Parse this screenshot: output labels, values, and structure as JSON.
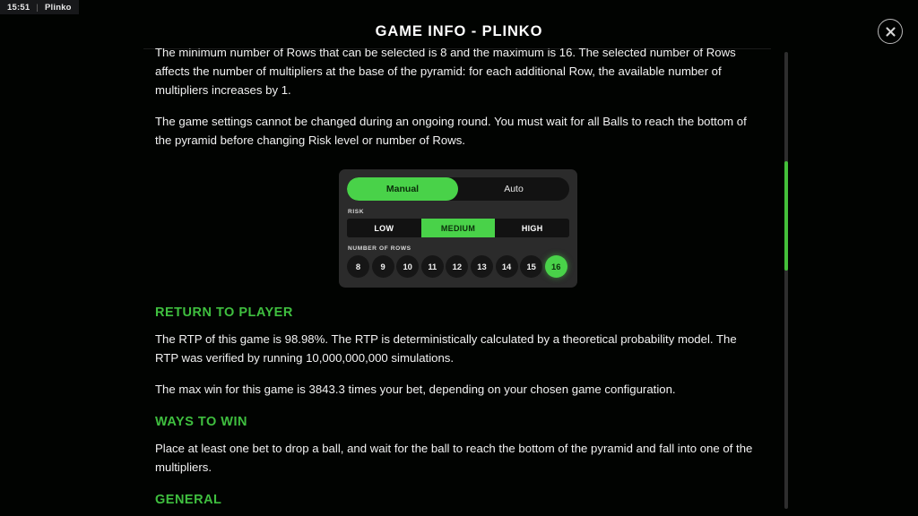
{
  "status_bar": {
    "time": "15:51",
    "separator": "|",
    "game_name": "Plinko"
  },
  "header": {
    "title": "GAME INFO - PLINKO",
    "close_label": "close-icon"
  },
  "content": {
    "paragraph_rows": "The minimum number of Rows that can be selected is 8 and the maximum is 16. The selected number of Rows affects the number of multipliers at the base of the pyramid: for each additional Row, the available number of multipliers increases by 1.",
    "paragraph_settings": "The game settings cannot be changed during an ongoing round. You must wait for all Balls to reach the bottom of the pyramid before changing Risk level or number of Rows.",
    "rtp_heading": "RETURN TO PLAYER",
    "rtp_paragraph": "The RTP of this game is 98.98%. The RTP is deterministically calculated by a theoretical probability model. The RTP was verified by running 10,000,000,000 simulations.",
    "max_win_paragraph": "The max win for this game is 3843.3 times your bet, depending on your chosen game configuration.",
    "ways_to_win_heading": "WAYS TO WIN",
    "ways_to_win_paragraph": "Place at least one bet to drop a ball, and wait for the ball to reach the bottom of the pyramid and fall into one of the multipliers.",
    "general_heading": "GENERAL"
  },
  "settings_figure": {
    "modes": [
      {
        "label": "Manual",
        "active": true
      },
      {
        "label": "Auto",
        "active": false
      }
    ],
    "risk_label": "RISK",
    "risk_options": [
      {
        "label": "LOW",
        "active": false
      },
      {
        "label": "MEDIUM",
        "active": true
      },
      {
        "label": "HIGH",
        "active": false
      }
    ],
    "rows_label": "NUMBER OF ROWS",
    "rows_options": [
      {
        "label": "8",
        "active": false
      },
      {
        "label": "9",
        "active": false
      },
      {
        "label": "10",
        "active": false
      },
      {
        "label": "11",
        "active": false
      },
      {
        "label": "12",
        "active": false
      },
      {
        "label": "13",
        "active": false
      },
      {
        "label": "14",
        "active": false
      },
      {
        "label": "15",
        "active": false
      },
      {
        "label": "16",
        "active": true
      }
    ]
  },
  "colors": {
    "accent_green": "#49d249",
    "heading_green": "#3fbf3f",
    "scrollbar_thumb": "#44c03a",
    "panel_bg": "#2b2b2b",
    "page_bg": "#010301"
  }
}
